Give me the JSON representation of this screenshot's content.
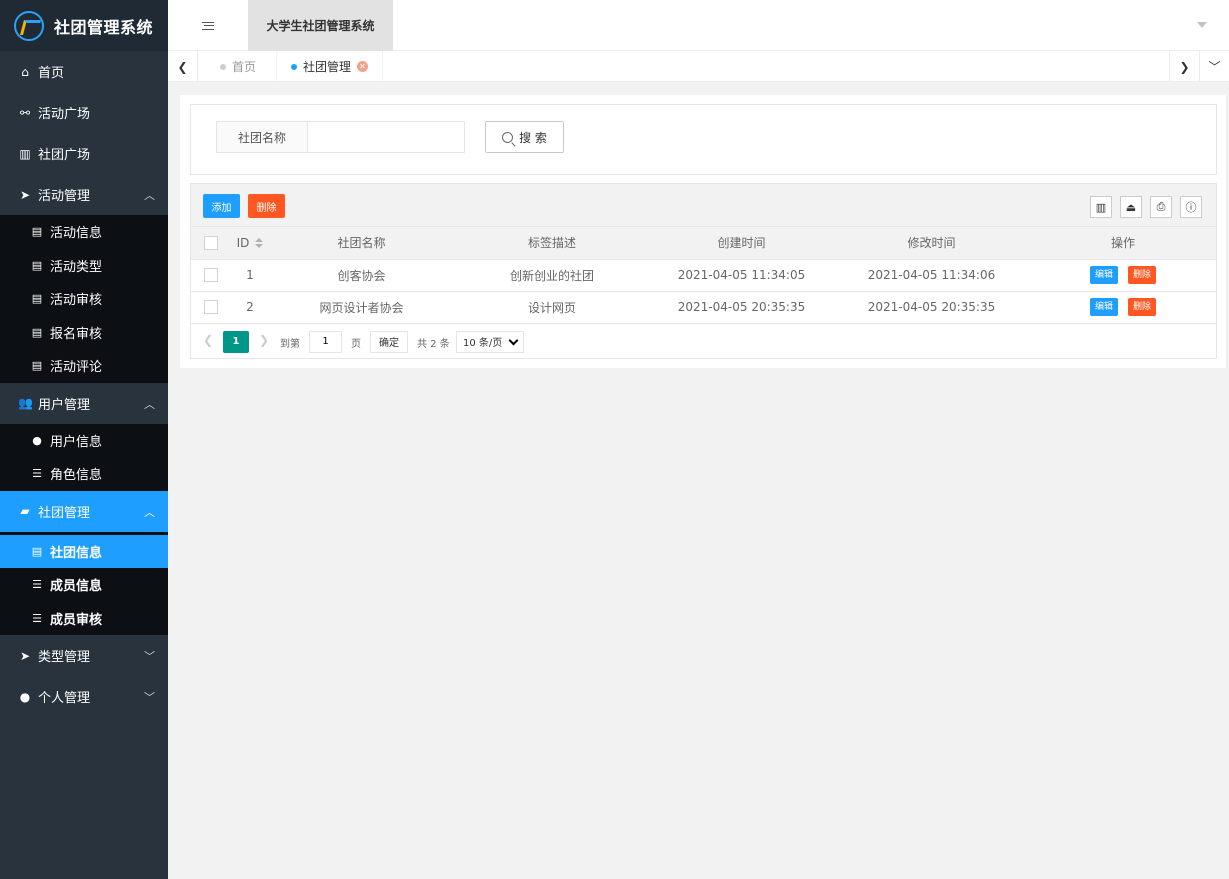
{
  "app": {
    "logo_text": "社团管理系统",
    "header_title": "大学生社团管理系统"
  },
  "sidebar": {
    "items": [
      {
        "label": "首页",
        "icon": "home-icon"
      },
      {
        "label": "活动广场",
        "icon": "motorcycle-icon"
      },
      {
        "label": "社团广场",
        "icon": "bank-icon"
      },
      {
        "label": "活动管理",
        "icon": "paper-plane-icon",
        "expanded": true,
        "children": [
          "活动信息",
          "活动类型",
          "活动审核",
          "报名审核",
          "活动评论"
        ]
      },
      {
        "label": "用户管理",
        "icon": "users-icon",
        "expanded": true,
        "children": [
          "用户信息",
          "角色信息"
        ]
      },
      {
        "label": "社团管理",
        "icon": "book-icon",
        "expanded": true,
        "active": true,
        "children": [
          "社团信息",
          "成员信息",
          "成员审核"
        ]
      },
      {
        "label": "类型管理",
        "icon": "paper-plane-icon",
        "expanded": false
      },
      {
        "label": "个人管理",
        "icon": "user-icon",
        "expanded": false
      }
    ]
  },
  "tabs": [
    {
      "label": "首页"
    },
    {
      "label": "社团管理"
    }
  ],
  "search": {
    "label": "社团名称",
    "value": "",
    "button": "搜 索"
  },
  "toolbar": {
    "add_label": "添加",
    "delete_label": "删除"
  },
  "table": {
    "headers": [
      "ID",
      "社团名称",
      "标签描述",
      "创建时间",
      "修改时间",
      "操作"
    ],
    "rows": [
      {
        "id": "1",
        "name": "创客协会",
        "desc": "创新创业的社团",
        "created": "2021-04-05 11:34:05",
        "modified": "2021-04-05 11:34:06"
      },
      {
        "id": "2",
        "name": "网页设计者协会",
        "desc": "设计网页",
        "created": "2021-04-05 20:35:35",
        "modified": "2021-04-05 20:35:35"
      }
    ],
    "edit_label": "编辑",
    "delete_label": "删除"
  },
  "pagination": {
    "current": "1",
    "goto_label": "到第",
    "page_input": "1",
    "page_unit": "页",
    "confirm": "确定",
    "total": "共 2 条",
    "page_size": "10 条/页"
  },
  "colors": {
    "sidebar_bg": "#28333e",
    "active_blue": "#1e9fff",
    "danger": "#ff5722",
    "pager_active": "#009688"
  }
}
